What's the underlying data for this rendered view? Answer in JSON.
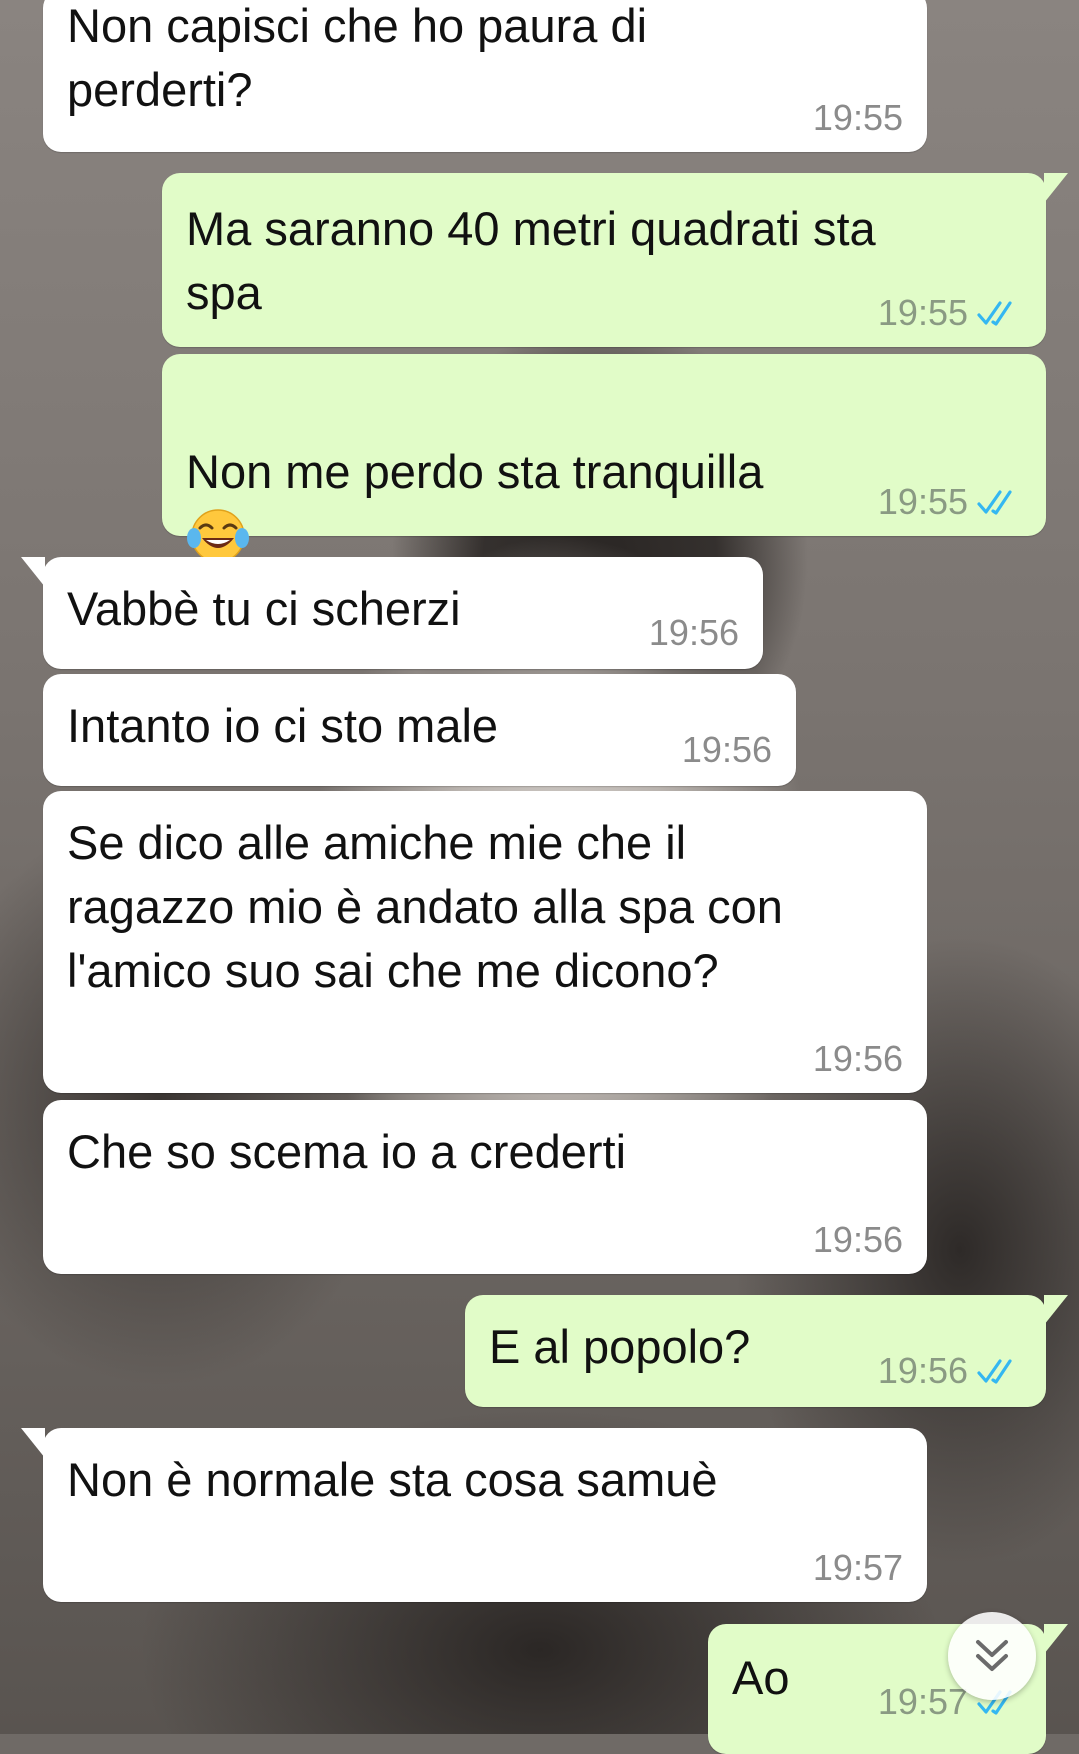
{
  "messages": [
    {
      "id": "m1",
      "direction": "incoming",
      "text": "Non capisci che ho paura di\nperderti?",
      "time": "19:55"
    },
    {
      "id": "m2",
      "direction": "outgoing",
      "text": "Ma saranno 40 metri quadrati sta\nspa",
      "time": "19:55",
      "status": "read"
    },
    {
      "id": "m3",
      "direction": "outgoing",
      "text": "Non me perdo sta tranquilla",
      "emoji": "face-with-tears-of-joy",
      "time": "19:55",
      "status": "read"
    },
    {
      "id": "m4",
      "direction": "incoming",
      "text": "Vabbè tu ci scherzi",
      "time": "19:56"
    },
    {
      "id": "m5",
      "direction": "incoming",
      "text": "Intanto io ci sto male",
      "time": "19:56"
    },
    {
      "id": "m6",
      "direction": "incoming",
      "text": "Se dico alle amiche mie che il\nragazzo mio è andato alla spa con\nl'amico suo sai che me dicono?",
      "time": "19:56"
    },
    {
      "id": "m7",
      "direction": "incoming",
      "text": "Che so scema io a crederti",
      "time": "19:56"
    },
    {
      "id": "m8",
      "direction": "outgoing",
      "text": "E al popolo?",
      "time": "19:56",
      "status": "read"
    },
    {
      "id": "m9",
      "direction": "incoming",
      "text": "Non è normale sta cosa samuè",
      "time": "19:57"
    },
    {
      "id": "m10",
      "direction": "outgoing",
      "text": "Ao",
      "time": "19:57",
      "status": "read"
    }
  ],
  "colors": {
    "incoming_bubble": "#ffffff",
    "outgoing_bubble": "#e1fcc8",
    "read_ticks": "#34b7f1",
    "timestamp": "#8b8b8b"
  },
  "controls": {
    "scroll_to_bottom_icon": "double-chevron-down-icon"
  }
}
